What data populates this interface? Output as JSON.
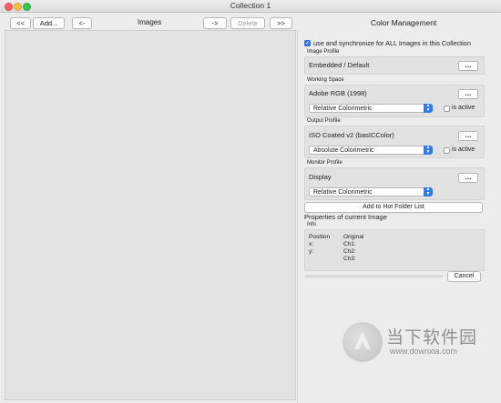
{
  "window": {
    "title": "Collection 1"
  },
  "toolbar": {
    "first_label": "<<",
    "add_label": "Add...",
    "prev_label": "<-",
    "images_header": "Images",
    "next_label": "->",
    "delete_label": "Delete",
    "last_label": ">>"
  },
  "color_management": {
    "header": "Color Management",
    "sync_label": "use and synchronize for ALL Images in this Collection",
    "sync_checked": true,
    "image_profile": {
      "section": "Image Profile",
      "value": "Embedded / Default",
      "browse": "..."
    },
    "working_space": {
      "section": "Working Space",
      "value": "Adobe RGB (1998)",
      "browse": "...",
      "intent": "Relative Colorimetric",
      "active_label": "is active",
      "active": false
    },
    "output_profile": {
      "section": "Output Profile",
      "value": "ISO Coated v2 (basICColor)",
      "browse": "...",
      "intent": "Absolute Colorimetric",
      "active_label": "is active",
      "active": false
    },
    "monitor_profile": {
      "section": "Monitor Profile",
      "value": "Display",
      "browse": "...",
      "intent": "Relative Colorimetric"
    },
    "hot_folder_button": "Add to Hot Folder List"
  },
  "properties": {
    "header": "Properties of current Image",
    "info_section": "Info",
    "position_label": "Position",
    "x_label": "x:",
    "y_label": "y:",
    "original_label": "Original",
    "ch1_label": "Ch1:",
    "ch2_label": "Ch2:",
    "ch3_label": "Ch3:",
    "cancel_label": "Cancel"
  },
  "watermark": {
    "brand": "当下软件园",
    "url": "www.downxia.com"
  }
}
